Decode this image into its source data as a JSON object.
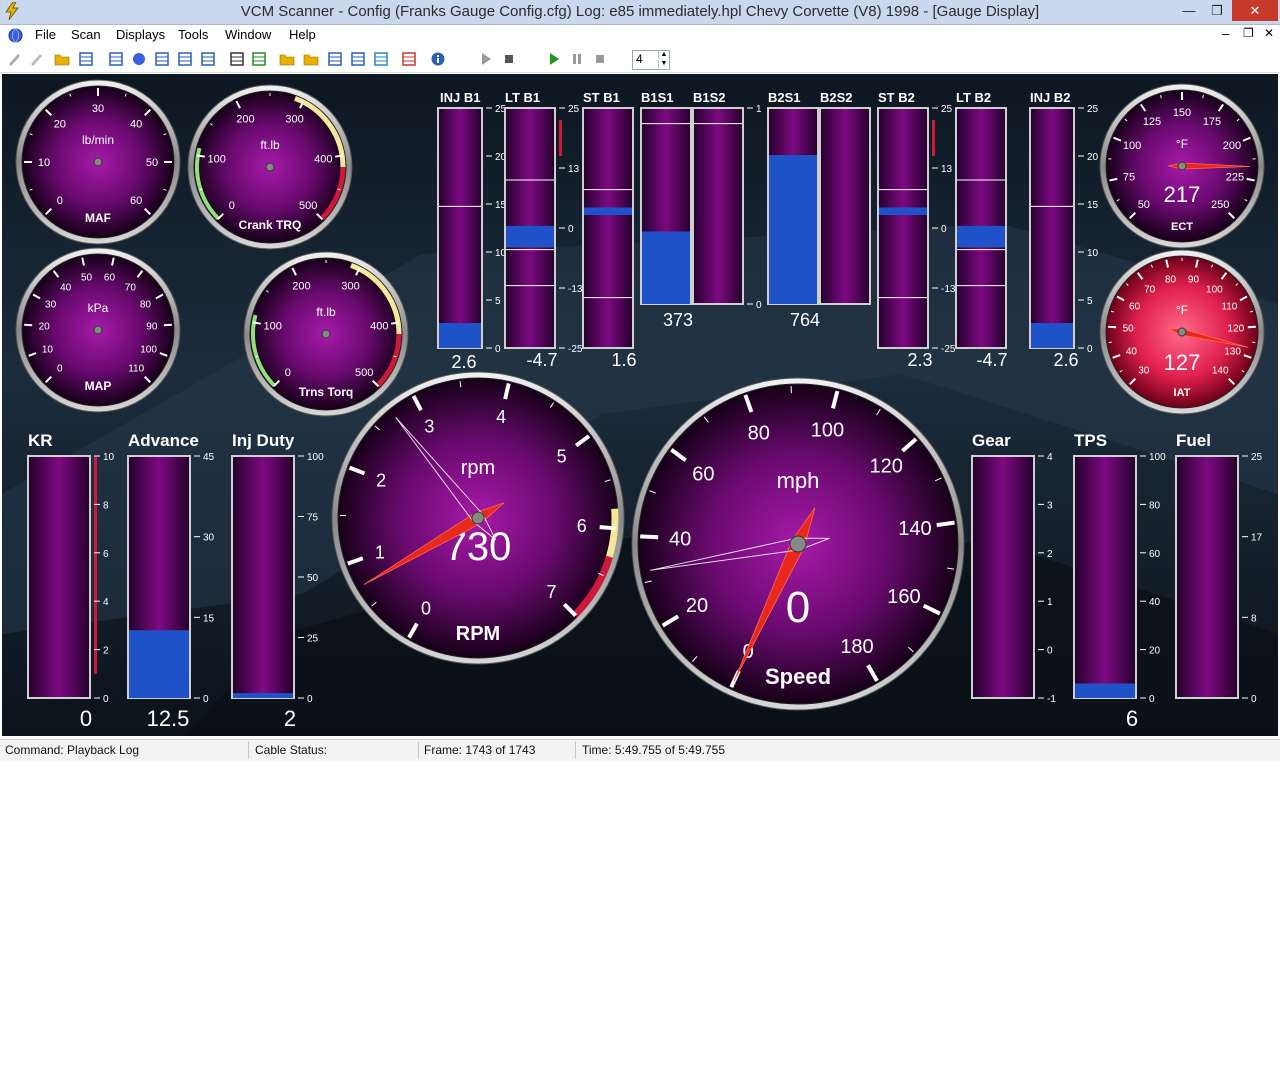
{
  "window": {
    "title": "VCM Scanner  -  Config  (Franks Gauge Config.cfg)    Log:  e85 immediately.hpl    Chevy Corvette (V8) 1998 - [Gauge Display]",
    "controls": [
      "—",
      "❐",
      "✕"
    ],
    "mdi_controls": [
      "–",
      "❐",
      "✕"
    ]
  },
  "menu": [
    "File",
    "Scan",
    "Displays",
    "Tools",
    "Window",
    "Help"
  ],
  "toolbar": {
    "icons": [
      "pencil-icon",
      "pencil-gray-icon",
      "open-folder-icon",
      "save-icon",
      "table-icon",
      "globe-icon",
      "chart-icon",
      "grid-icon",
      "list-icon",
      "engine-icon",
      "dtc-icon",
      "folder-open-icon",
      "folder-icon",
      "save-disk-icon",
      "document-icon",
      "export-icon",
      "settings-icon",
      "info-icon",
      "play-gray-icon",
      "stop-icon",
      "play-icon",
      "pause-icon",
      "stop-gray-icon"
    ],
    "speed_value": "4"
  },
  "status": {
    "command": "Command:  Playback Log",
    "cable": "Cable Status:",
    "frame": "Frame:  1743 of 1743",
    "time": "Time:  5:49.755 of 5:49.755"
  },
  "colors": {
    "accent_blue": "#1f52c8",
    "gauge_purple": "#7a0d80",
    "needle_red": "#e4261a",
    "redline": "#d0183a",
    "yellowline": "#e8d67a"
  },
  "small_gauges": [
    {
      "id": "maf",
      "label": "MAF",
      "unit": "lb/min",
      "ticks": [
        "0",
        "10",
        "20",
        "30",
        "40",
        "50",
        "60"
      ],
      "value": null
    },
    {
      "id": "crank",
      "label": "Crank TRQ",
      "unit": "ft.lb",
      "ticks": [
        "0",
        "100",
        "200",
        "300",
        "400",
        "500"
      ],
      "value": null
    },
    {
      "id": "map",
      "label": "MAP",
      "unit": "kPa",
      "ticks": [
        "0",
        "10",
        "20",
        "30",
        "40",
        "50",
        "60",
        "70",
        "80",
        "90",
        "100",
        "110"
      ],
      "value": null
    },
    {
      "id": "trans",
      "label": "Trns Torq",
      "unit": "ft.lb",
      "ticks": [
        "0",
        "100",
        "200",
        "300",
        "400",
        "500"
      ],
      "value": null
    },
    {
      "id": "ect",
      "label": "ECT",
      "unit": "°F",
      "ticks": [
        "50",
        "75",
        "100",
        "125",
        "150",
        "175",
        "200",
        "225",
        "250"
      ],
      "value": "217",
      "needle": 217
    },
    {
      "id": "iat",
      "label": "IAT",
      "unit": "°F",
      "ticks": [
        "30",
        "40",
        "50",
        "60",
        "70",
        "80",
        "90",
        "100",
        "110",
        "120",
        "130",
        "140"
      ],
      "value": "127",
      "needle": 127
    }
  ],
  "big_gauges": [
    {
      "id": "rpm",
      "label": "RPM",
      "unit": "rpm",
      "ticks": [
        "0",
        "1",
        "2",
        "3",
        "4",
        "5",
        "6",
        "7"
      ],
      "value": "730",
      "needle": 0.73
    },
    {
      "id": "speed",
      "label": "Speed",
      "unit": "mph",
      "ticks": [
        "0",
        "20",
        "40",
        "60",
        "80",
        "100",
        "120",
        "140",
        "160",
        "180"
      ],
      "value": "0",
      "needle": 0
    }
  ],
  "top_bars": [
    {
      "label": "INJ B1",
      "value": "2.6",
      "scale": [
        "25",
        "20",
        "15",
        "10",
        "5",
        "0"
      ],
      "fill": 0.104
    },
    {
      "label": "LT B1",
      "value": "-4.7",
      "scale": [
        "25",
        "13",
        "0",
        "-13",
        "-25"
      ],
      "band": [
        -6,
        0
      ]
    },
    {
      "label": "ST B1",
      "value": "1.6",
      "scale": [],
      "band": [
        0,
        2
      ]
    },
    {
      "label": "B1S1",
      "value": "373",
      "scale": [],
      "fill": 0.37
    },
    {
      "label": "B1S2",
      "value": "",
      "scale": [
        "1",
        "0"
      ],
      "fill": 0
    },
    {
      "label": "B2S1",
      "value": "764",
      "scale": [],
      "fill": 0.76
    },
    {
      "label": "B2S2",
      "value": "",
      "scale": [],
      "fill": 0
    },
    {
      "label": "ST B2",
      "value": "2.3",
      "scale": [
        "25",
        "13",
        "0",
        "-13",
        "-25"
      ],
      "band": [
        0,
        2.5
      ]
    },
    {
      "label": "LT B2",
      "value": "-4.7",
      "scale": [],
      "band": [
        -6,
        0
      ]
    },
    {
      "label": "INJ B2",
      "value": "2.6",
      "scale": [
        "25",
        "20",
        "15",
        "10",
        "5",
        "0"
      ],
      "fill": 0.104
    }
  ],
  "bottom_bars": [
    {
      "label": "KR",
      "value": "0",
      "scale": [
        "10",
        "8",
        "6",
        "4",
        "2",
        "0"
      ],
      "fill": 0
    },
    {
      "label": "Advance",
      "value": "12.5",
      "scale": [
        "45",
        "30",
        "15",
        "0"
      ],
      "fill": 0.28
    },
    {
      "label": "Inj Duty",
      "value": "2",
      "scale": [
        "100",
        "75",
        "50",
        "25",
        "0"
      ],
      "fill": 0.02
    },
    {
      "label": "Gear",
      "value": "",
      "scale": [
        "4",
        "3",
        "2",
        "1",
        "0",
        "-1"
      ],
      "fill": 0
    },
    {
      "label": "TPS",
      "value": "6",
      "scale": [
        "100",
        "80",
        "60",
        "40",
        "20",
        "0"
      ],
      "fill": 0.06
    },
    {
      "label": "Fuel",
      "value": "",
      "scale": [
        "25",
        "17",
        "8",
        "0"
      ],
      "fill": 0
    }
  ]
}
